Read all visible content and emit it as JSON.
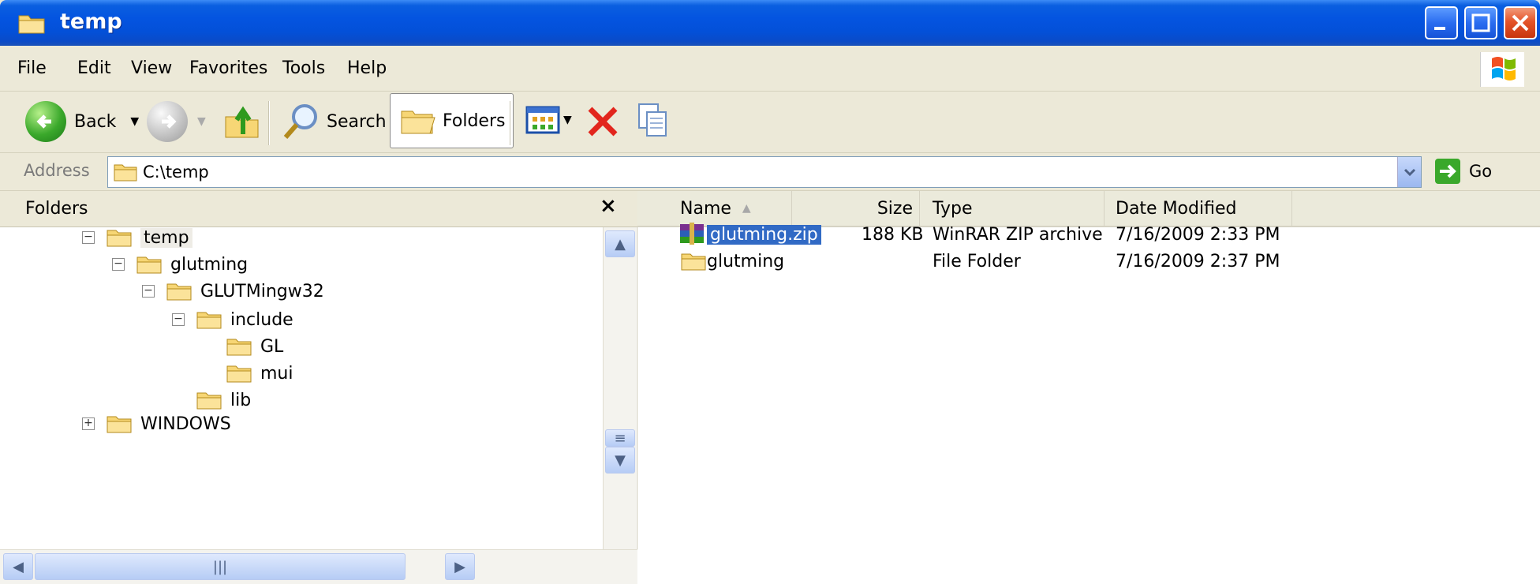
{
  "window": {
    "title": "temp"
  },
  "menu": [
    "File",
    "Edit",
    "View",
    "Favorites",
    "Tools",
    "Help"
  ],
  "toolbar": {
    "back_label": "Back",
    "search_label": "Search",
    "folders_label": "Folders"
  },
  "address": {
    "label": "Address",
    "path": "C:\\temp",
    "go_label": "Go"
  },
  "folders_pane": {
    "title": "Folders",
    "close_glyph": "×",
    "tree": [
      {
        "label": "temp",
        "expander": "⊟"
      },
      {
        "label": "glutming",
        "expander": "⊟"
      },
      {
        "label": "GLUTMingw32",
        "expander": "⊟"
      },
      {
        "label": "include",
        "expander": "⊟"
      },
      {
        "label": "GL",
        "expander": ""
      },
      {
        "label": "mui",
        "expander": ""
      },
      {
        "label": "lib",
        "expander": ""
      },
      {
        "label": "WINDOWS",
        "expander": "⊞"
      }
    ]
  },
  "file_list": {
    "columns": {
      "name": "Name",
      "size": "Size",
      "type": "Type",
      "date": "Date Modified"
    },
    "rows": [
      {
        "name": "glutming.zip",
        "size": "188 KB",
        "type": "WinRAR ZIP archive",
        "date": "7/16/2009 2:33 PM",
        "icon": "winrar-archive-icon"
      },
      {
        "name": "glutming",
        "size": "",
        "type": "File Folder",
        "date": "7/16/2009 2:37 PM",
        "icon": "folder-icon"
      }
    ]
  },
  "colors": {
    "titlebar": "#0454e0",
    "selection": "#316ac5",
    "chrome": "#ece9d8"
  }
}
